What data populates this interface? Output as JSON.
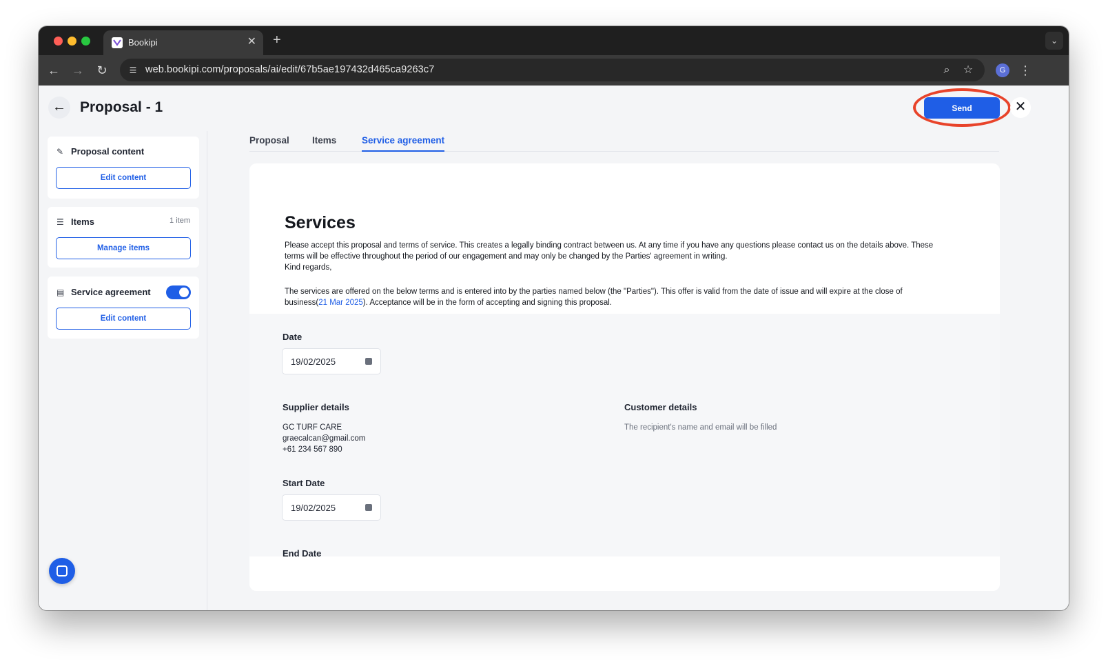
{
  "browser": {
    "tab_title": "Bookipi",
    "url": "web.bookipi.com/proposals/ai/edit/67b5ae197432d465ca9263c7",
    "profile_initial": "G"
  },
  "header": {
    "title": "Proposal - 1",
    "send_label": "Send"
  },
  "sidebar": {
    "proposal_content": {
      "title": "Proposal content",
      "button": "Edit content"
    },
    "items": {
      "title": "Items",
      "count": "1 item",
      "button": "Manage items"
    },
    "service_agreement": {
      "title": "Service agreement",
      "enabled": true,
      "button": "Edit content"
    }
  },
  "tabs": [
    {
      "label": "Proposal",
      "active": false
    },
    {
      "label": "Items",
      "active": false
    },
    {
      "label": "Service agreement",
      "active": true
    }
  ],
  "document": {
    "heading": "Services",
    "para1_line1": "Please accept this proposal and terms of service. This creates a legally binding contract between us. At any time if you have any questions please contact us on the details above. These",
    "para1_line2": "terms will be effective throughout the period of our engagement and may only be changed by the Parties' agreement in writing.",
    "para1_line3": "Kind regards,",
    "para2_line1": "The services are offered on the below terms and is entered into by the parties named below (the \"Parties\"). This offer is valid from the date of issue and will expire at the close of",
    "para2_prefix": "business(",
    "para2_date": "21 Mar 2025",
    "para2_suffix": "). Acceptance will be in the form of accepting and signing this proposal."
  },
  "form": {
    "date_label": "Date",
    "date_value": "19/02/2025",
    "supplier_label": "Supplier details",
    "supplier_name": "GC TURF CARE",
    "supplier_email": "graecalcan@gmail.com",
    "supplier_phone": "+61 234 567 890",
    "customer_label": "Customer details",
    "customer_note": "The recipient's name and email will be filled",
    "start_date_label": "Start Date",
    "start_date_value": "19/02/2025",
    "end_date_label": "End Date"
  },
  "colors": {
    "accent": "#1f5ee6",
    "annotation_ring": "#e8432a"
  }
}
